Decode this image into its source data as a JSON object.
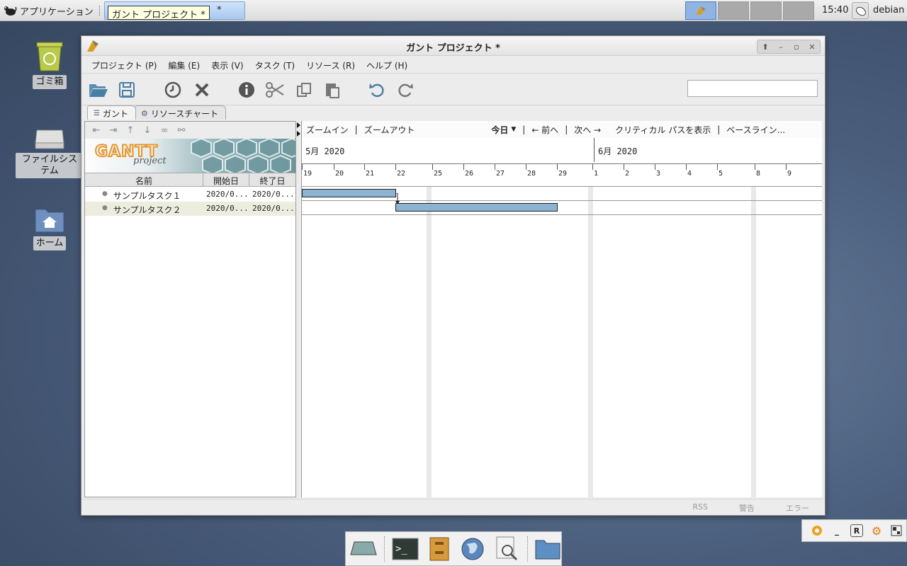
{
  "panel": {
    "apps_label": "アプリケーション",
    "task_button": "ガント プロジェクト *",
    "tooltip": "ガント プロジェクト *",
    "clock": "15:40",
    "user": "debian"
  },
  "desktop": {
    "trash": "ゴミ箱",
    "filesystem": "ファイルシステム",
    "home": "ホーム"
  },
  "window": {
    "title": "ガント プロジェクト *",
    "menus": [
      "プロジェクト (P)",
      "編集 (E)",
      "表示 (V)",
      "タスク (T)",
      "リソース (R)",
      "ヘルプ (H)"
    ],
    "search_value": ""
  },
  "tabs": {
    "gantt": "ガント",
    "resource": "リソースチャート"
  },
  "logo": {
    "gantt": "GANTT",
    "project": "project"
  },
  "grid": {
    "headers": {
      "name": "名前",
      "start": "開始日",
      "end": "終了日"
    },
    "rows": [
      {
        "name": "サンプルタスク１",
        "start": "2020/0...",
        "end": "2020/0..."
      },
      {
        "name": "サンプルタスク２",
        "start": "2020/0...",
        "end": "2020/0..."
      }
    ]
  },
  "chart": {
    "nav": {
      "zoom_in": "ズームイン",
      "zoom_out": "ズームアウト",
      "today": "今日",
      "prev": "← 前へ",
      "next": "次へ →",
      "critical": "クリティカル パスを表示",
      "baseline": "ベースライン..."
    },
    "months": [
      "5月 2020",
      "6月 2020"
    ],
    "days": [
      "19",
      "20",
      "21",
      "22",
      "25",
      "26",
      "27",
      "28",
      "29",
      "1",
      "2",
      "3",
      "4",
      "5",
      "8",
      "9"
    ]
  },
  "status": {
    "rss": "RSS",
    "warning": "警告",
    "error": "エラー"
  },
  "colors": {
    "bar": "#8db3d3",
    "accent": "#8fb4e3"
  }
}
